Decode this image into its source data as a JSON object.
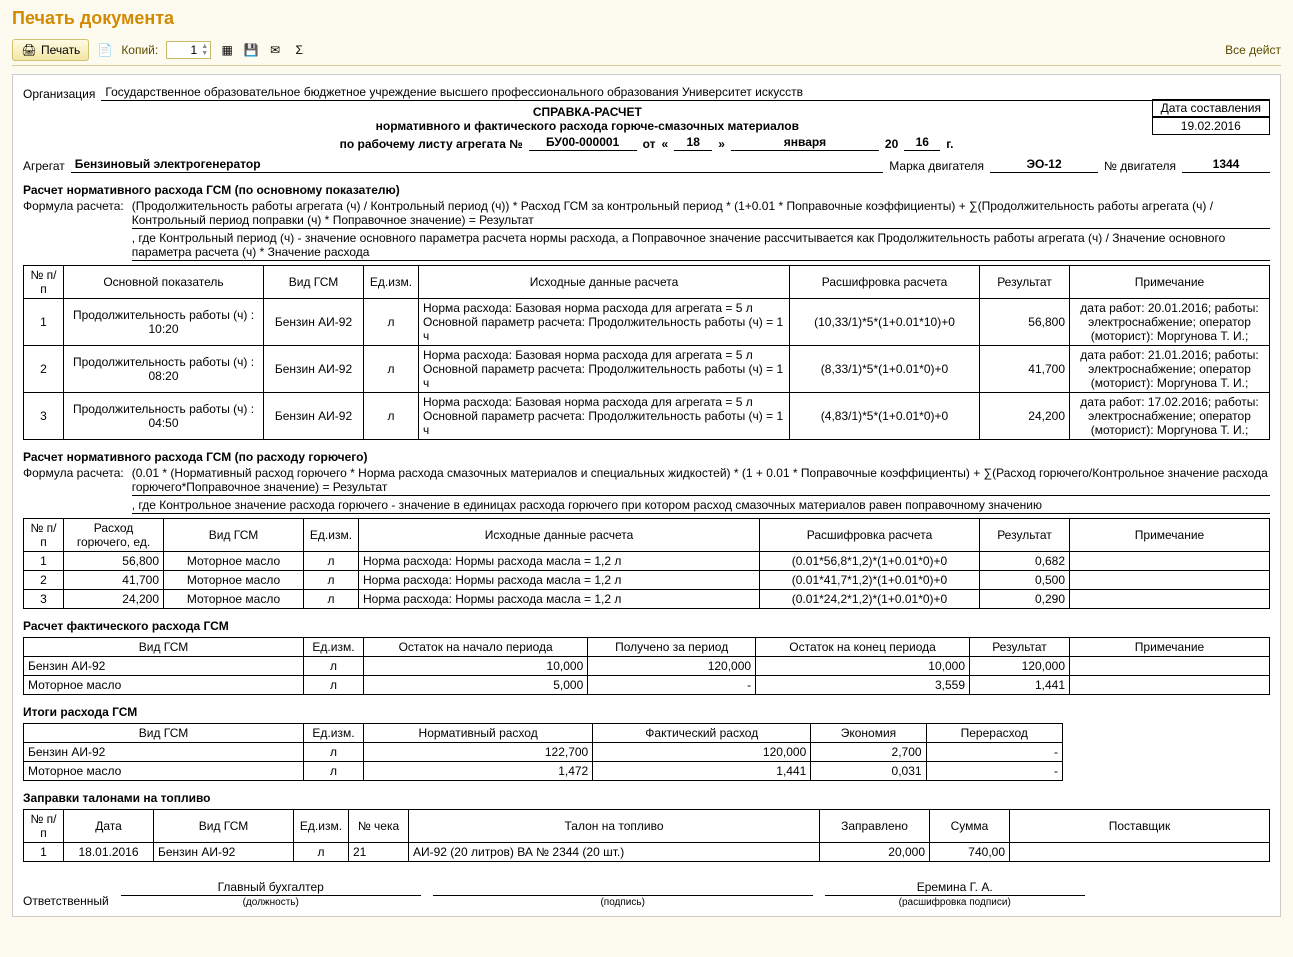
{
  "title": "Печать документа",
  "toolbar": {
    "print": "Печать",
    "copies_label": "Копий:",
    "copies_value": "1",
    "all_actions": "Все дейст"
  },
  "icons": {
    "printer": "🖨",
    "page": "📄",
    "grid": "▦",
    "save": "💾",
    "mail": "✉",
    "sigma": "Σ"
  },
  "header": {
    "org_label": "Организация",
    "org_value": "Государственное образовательное бюджетное учреждение высшего профессионального образования  Университет искусств",
    "doc_title": "СПРАВКА-РАСЧЕТ",
    "doc_sub": "нормативного и фактического расхода горюче-смазочных материалов",
    "sheet_prefix": "по рабочему листу агрегата  №",
    "sheet_no": "БУ00-000001",
    "from": "от",
    "q1": "«",
    "day": "18",
    "q2": "»",
    "month": "января",
    "year_prefix": "20",
    "year": "16",
    "year_suffix": "г.",
    "date_box_label": "Дата составления",
    "date_box_value": "19.02.2016",
    "unit_label": "Агрегат",
    "unit_value": "Бензиновый электрогенератор",
    "engine_brand_label": "Марка двигателя",
    "engine_brand": "ЭО-12",
    "engine_no_label": "№ двигателя",
    "engine_no": "1344"
  },
  "norm1": {
    "section": "Расчет нормативного расхода ГСМ (по основному показателю)",
    "formula_label": "Формула расчета:",
    "formula1": "(Продолжительность работы агрегата (ч) / Контрольный период (ч)) * Расход ГСМ за контрольный период * (1+0.01 * Поправочные коэффициенты) + ∑(Продолжительность работы агрегата (ч) / Контрольный период поправки (ч) * Поправочное значение) = Результат",
    "formula2": ", где Контрольный период (ч) - значение основного параметра расчета нормы расхода, а Поправочное значение рассчитывается как Продолжительность работы агрегата (ч) / Значение основного параметра расчета (ч) * Значение расхода",
    "cols": [
      "№ п/п",
      "Основной показатель",
      "Вид ГСМ",
      "Ед.изм.",
      "Исходные данные расчета",
      "Расшифровка расчета",
      "Результат",
      "Примечание"
    ],
    "rows": [
      {
        "n": "1",
        "ind": "Продолжительность работы (ч) : 10:20",
        "gsm": "Бензин АИ-92",
        "u": "л",
        "src": "Норма расхода: Базовая норма расхода для агрегата = 5 л\nОсновной параметр расчета: Продолжительность работы (ч) = 1 ч",
        "calc": "(10,33/1)*5*(1+0.01*10)+0",
        "res": "56,800",
        "note": "дата работ: 20.01.2016; работы: электроснабжение; оператор (моторист): Моргунова Т. И.;"
      },
      {
        "n": "2",
        "ind": "Продолжительность работы (ч) : 08:20",
        "gsm": "Бензин АИ-92",
        "u": "л",
        "src": "Норма расхода: Базовая норма расхода для агрегата = 5 л\nОсновной параметр расчета: Продолжительность работы (ч) = 1 ч",
        "calc": "(8,33/1)*5*(1+0.01*0)+0",
        "res": "41,700",
        "note": "дата работ: 21.01.2016; работы: электроснабжение; оператор (моторист): Моргунова Т. И.;"
      },
      {
        "n": "3",
        "ind": "Продолжительность работы (ч) : 04:50",
        "gsm": "Бензин АИ-92",
        "u": "л",
        "src": "Норма расхода: Базовая норма расхода для агрегата = 5 л\nОсновной параметр расчета: Продолжительность работы (ч) = 1 ч",
        "calc": "(4,83/1)*5*(1+0.01*0)+0",
        "res": "24,200",
        "note": "дата работ: 17.02.2016; работы: электроснабжение; оператор (моторист): Моргунова Т. И.;"
      }
    ]
  },
  "norm2": {
    "section": "Расчет нормативного расхода ГСМ (по расходу горючего)",
    "formula_label": "Формула расчета:",
    "formula1": "(0.01 * (Нормативный расход горючего * Норма расхода смазочных материалов и специальных жидкостей) * (1 + 0.01 * Поправочные коэффициенты) + ∑(Расход горючего/Контрольное значение расхода горючего*Поправочное значение) = Результат",
    "formula2": ", где Контрольное значение расхода горючего - значение в единицах расхода горючего при котором расход смазочных материалов равен поправочному значению",
    "cols": [
      "№ п/п",
      "Расход горючего, ед.",
      "Вид ГСМ",
      "Ед.изм.",
      "Исходные данные расчета",
      "Расшифровка расчета",
      "Результат",
      "Примечание"
    ],
    "rows": [
      {
        "n": "1",
        "fuel": "56,800",
        "gsm": "Моторное масло",
        "u": "л",
        "src": "Норма расхода: Нормы расхода масла  = 1,2 л",
        "calc": "(0.01*56,8*1,2)*(1+0.01*0)+0",
        "res": "0,682",
        "note": ""
      },
      {
        "n": "2",
        "fuel": "41,700",
        "gsm": "Моторное масло",
        "u": "л",
        "src": "Норма расхода: Нормы расхода масла  = 1,2 л",
        "calc": "(0.01*41,7*1,2)*(1+0.01*0)+0",
        "res": "0,500",
        "note": ""
      },
      {
        "n": "3",
        "fuel": "24,200",
        "gsm": "Моторное масло",
        "u": "л",
        "src": "Норма расхода: Нормы расхода масла  = 1,2 л",
        "calc": "(0.01*24,2*1,2)*(1+0.01*0)+0",
        "res": "0,290",
        "note": ""
      }
    ]
  },
  "fact": {
    "section": "Расчет фактического расхода ГСМ",
    "cols": [
      "Вид ГСМ",
      "Ед.изм.",
      "Остаток на начало периода",
      "Получено за период",
      "Остаток на конец периода",
      "Результат",
      "Примечание"
    ],
    "rows": [
      {
        "gsm": "Бензин АИ-92",
        "u": "л",
        "start": "10,000",
        "recv": "120,000",
        "end": "10,000",
        "res": "120,000",
        "note": ""
      },
      {
        "gsm": "Моторное масло",
        "u": "л",
        "start": "5,000",
        "recv": "-",
        "end": "3,559",
        "res": "1,441",
        "note": ""
      }
    ]
  },
  "totals": {
    "section": "Итоги расхода ГСМ",
    "cols": [
      "Вид ГСМ",
      "Ед.изм.",
      "Нормативный расход",
      "Фактический расход",
      "Экономия",
      "Перерасход"
    ],
    "rows": [
      {
        "gsm": "Бензин АИ-92",
        "u": "л",
        "norm": "122,700",
        "fact": "120,000",
        "econ": "2,700",
        "over": "-"
      },
      {
        "gsm": "Моторное масло",
        "u": "л",
        "norm": "1,472",
        "fact": "1,441",
        "econ": "0,031",
        "over": "-"
      }
    ]
  },
  "coupons": {
    "section": "Заправки талонами на топливо",
    "cols": [
      "№ п/п",
      "Дата",
      "Вид ГСМ",
      "Ед.изм.",
      "№ чека",
      "Талон на топливо",
      "Заправлено",
      "Сумма",
      "Поставщик"
    ],
    "rows": [
      {
        "n": "1",
        "date": "18.01.2016",
        "gsm": "Бензин АИ-92",
        "u": "л",
        "chk": "21",
        "coupon": "АИ-92 (20 литров) ВА № 2344 (20 шт.)",
        "amount": "20,000",
        "sum": "740,00",
        "supplier": ""
      }
    ]
  },
  "sign": {
    "resp_label": "Ответственный",
    "position": "Главный бухгалтер",
    "name": "Еремина Г. А.",
    "cap_position": "(должность)",
    "cap_sign": "(подпись)",
    "cap_name": "(расшифровка подписи)"
  }
}
